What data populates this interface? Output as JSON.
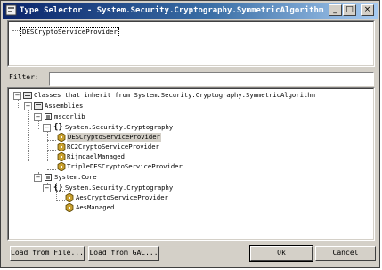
{
  "window": {
    "title": "Type Selector - System.Security.Cryptography.SymmetricAlgorithm",
    "minimize_glyph": "_",
    "maximize_glyph": "□",
    "close_glyph": "×"
  },
  "selection": {
    "text": "DESCryptoServiceProvider"
  },
  "filter": {
    "label": "Filter:",
    "value": ""
  },
  "tree": {
    "root": "Classes that inherit from System.Security.Cryptography.SymmetricAlgorithm",
    "assemblies": "Assemblies",
    "mscorlib": "mscorlib",
    "ns1": "System.Security.Cryptography",
    "des": "DESCryptoServiceProvider",
    "rc2": "RC2CryptoServiceProvider",
    "rijndael": "RijndaelManaged",
    "tripledes": "TripleDESCryptoServiceProvider",
    "core": "System.Core",
    "ns2": "System.Security.Cryptography",
    "aescsp": "AesCryptoServiceProvider",
    "aesmanaged": "AesManaged",
    "expanded_glyph": "−"
  },
  "buttons": {
    "load_file": "Load from File...",
    "load_gac": "Load from GAC...",
    "ok": "Ok",
    "cancel": "Cancel"
  },
  "colors": {
    "title_start": "#0a246a",
    "title_end": "#a6caf0",
    "face": "#d4d0c8"
  }
}
